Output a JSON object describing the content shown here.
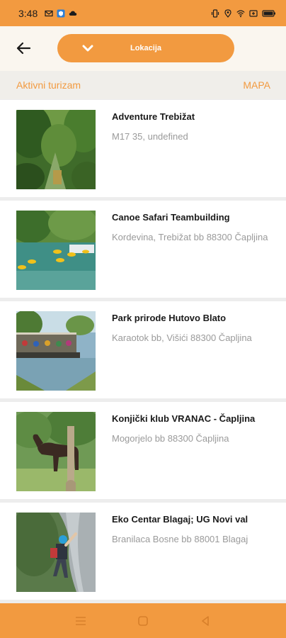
{
  "status_bar": {
    "time": "3:48",
    "left_icons": [
      "mail-icon",
      "vpn-icon",
      "cloud-icon"
    ],
    "right_icons": [
      "vibrate-icon",
      "location-icon",
      "wifi-icon",
      "battery-saver-icon",
      "battery-icon"
    ]
  },
  "header": {
    "back_icon": "arrow-left-icon",
    "location_button_label": "Lokacija",
    "location_chevron_icon": "chevron-down-icon"
  },
  "subheader": {
    "category": "Aktivni turizam",
    "map_link": "MAPA"
  },
  "items": [
    {
      "title": "Adventure Trebižat",
      "address": "M17 35, undefined"
    },
    {
      "title": "Canoe Safari Teambuilding",
      "address": "Kordevina, Trebižat bb 88300 Čapljina"
    },
    {
      "title": "Park prirode Hutovo Blato",
      "address": "Karaotok bb, Višići 88300 Čapljina"
    },
    {
      "title": "Konjički klub VRANAC - Čapljina",
      "address": "Mogorjelo bb 88300 Čapljina"
    },
    {
      "title": "Eko Centar Blagaj; UG Novi val",
      "address": "Branilaca Bosne bb 88001 Blagaj"
    }
  ],
  "nav_bar": {
    "icons": [
      "menu-icon",
      "home-square-icon",
      "back-triangle-icon"
    ]
  },
  "colors": {
    "accent": "#f29a40",
    "header_bg": "#faf6ef",
    "subheader_bg": "#f0eeea",
    "address_gray": "#9a9a9a"
  }
}
